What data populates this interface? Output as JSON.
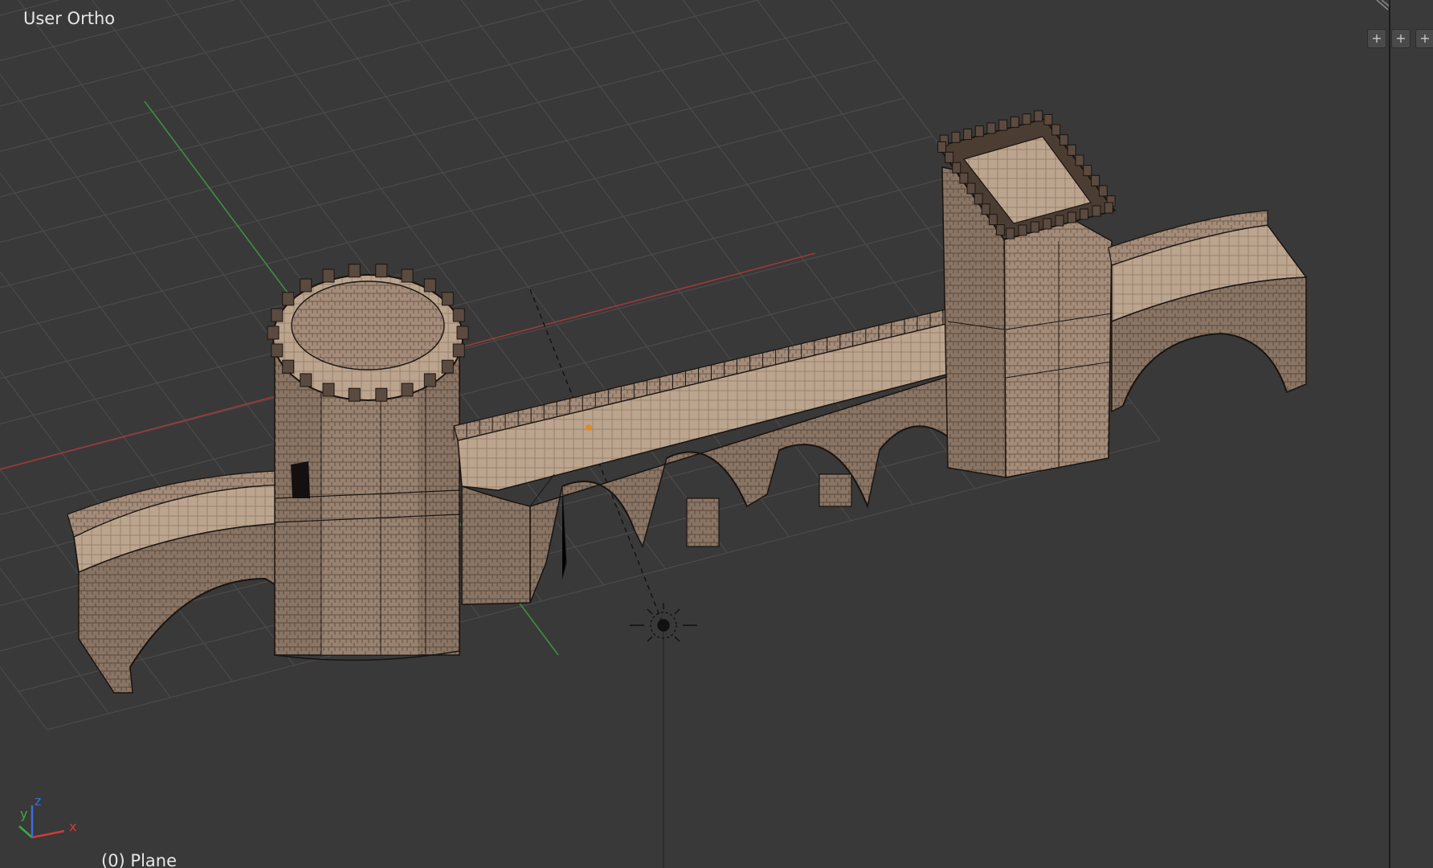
{
  "viewport": {
    "view_name": "User Ortho",
    "object_name": "(0) Plane",
    "background_color": "#393939",
    "grid_color": "#4a4a4a",
    "x_axis_color": "#a13838",
    "y_axis_color": "#3f8f3f",
    "model": "castle-bridge"
  },
  "gizmo": {
    "x_label": "x",
    "y_label": "y",
    "z_label": "z",
    "x_color": "#d03a3a",
    "y_color": "#3cab3c",
    "z_color": "#3f6bd8"
  },
  "widgets": {
    "split_icon": "plus-icon",
    "split_glyph": "+"
  }
}
